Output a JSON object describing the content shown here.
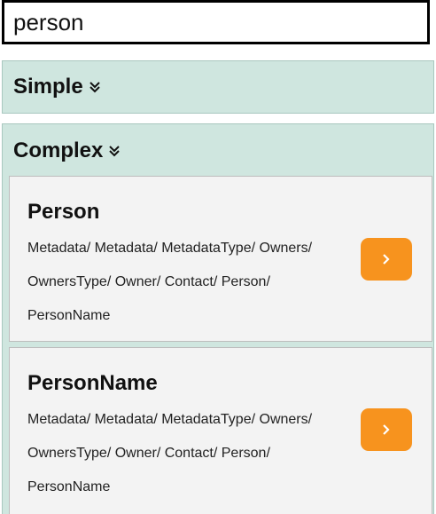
{
  "search": {
    "value": "person",
    "placeholder": ""
  },
  "sections": [
    {
      "label": "Simple",
      "icon": "double-chevron-down-icon"
    },
    {
      "label": "Complex",
      "icon": "double-chevron-down-icon"
    }
  ],
  "results": [
    {
      "title": "Person",
      "path": "Metadata/ Metadata/ MetadataType/ Owners/ OwnersType/ Owner/ Contact/ Person/ PersonName",
      "button_icon": "chevron-right-icon"
    },
    {
      "title": "PersonName",
      "path": "Metadata/ Metadata/ MetadataType/ Owners/ OwnersType/ Owner/ Contact/ Person/ PersonName",
      "button_icon": "chevron-right-icon"
    }
  ],
  "colors": {
    "section_bg": "#cfe6df",
    "card_bg": "#f3f3f3",
    "accent": "#f7931e"
  }
}
